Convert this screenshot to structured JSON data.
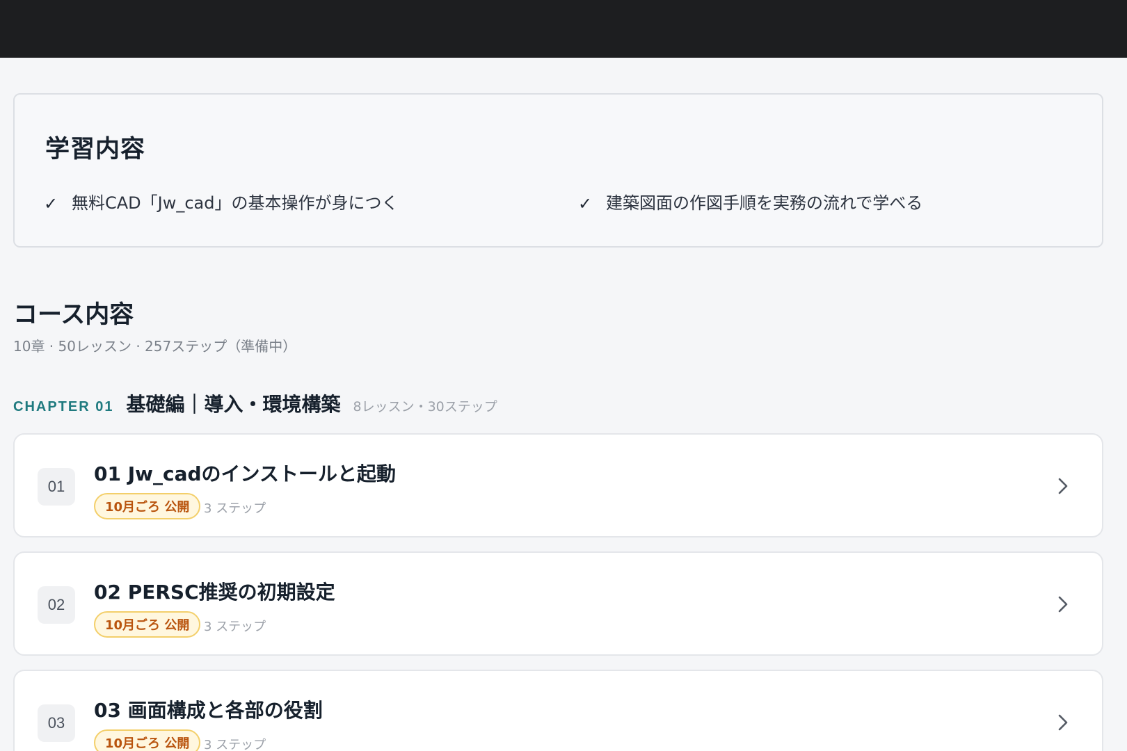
{
  "learning": {
    "title": "学習内容",
    "items": [
      {
        "check": "✓",
        "text": "無料CAD「Jw_cad」の基本操作が身につく"
      },
      {
        "check": "✓",
        "text": "建築図面の作図手順を実務の流れで学べる"
      }
    ]
  },
  "course": {
    "title": "コース内容",
    "summary": "10章 · 50レッスン · 257ステップ（準備中）"
  },
  "chapter": {
    "tag": "CHAPTER 01",
    "name": "基礎編｜導入・環境構築",
    "meta": "8レッスン・30ステップ"
  },
  "lessons": [
    {
      "num": "01",
      "title": "01 Jw_cadのインストールと起動",
      "badge": "10月ごろ 公開",
      "steps": "3 ステップ",
      "icon": "chevron-right-icon"
    },
    {
      "num": "02",
      "title": "02 PERSC推奨の初期設定",
      "badge": "10月ごろ 公開",
      "steps": "3 ステップ",
      "icon": "chevron-right-icon"
    },
    {
      "num": "03",
      "title": "03 画面構成と各部の役割",
      "badge": "10月ごろ 公開",
      "steps": "3 ステップ",
      "icon": "chevron-right-icon"
    }
  ],
  "colors": {
    "topbar": "#1d1e20",
    "chapter_accent": "#1f7a7f",
    "badge_text": "#b9540e",
    "badge_border": "#f3cf6a"
  }
}
